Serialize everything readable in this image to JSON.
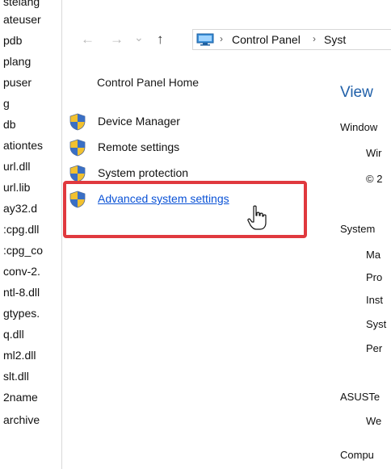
{
  "left_files": [
    "stelang",
    "ateuser",
    "pdb",
    "plang",
    "puser",
    "g",
    "db",
    "ationtes",
    "url.dll",
    "url.lib",
    "ay32.d",
    ":cpg.dll",
    ":cpg_co",
    "conv-2.",
    "ntl-8.dll",
    "gtypes.",
    "q.dll",
    "ml2.dll",
    "slt.dll",
    "2name",
    "archive"
  ],
  "address": {
    "back_glyph": "←",
    "forward_glyph": "→",
    "dropdown_glyph": "⌄",
    "up_glyph": "↑",
    "sep": "›",
    "crumbs": [
      "Control Panel",
      "Syst"
    ]
  },
  "sidebar": {
    "home": "Control Panel Home",
    "tasks": [
      {
        "label": "Device Manager"
      },
      {
        "label": "Remote settings"
      },
      {
        "label": "System protection"
      },
      {
        "label": "Advanced system settings"
      }
    ]
  },
  "right": {
    "title": "View",
    "lines": [
      "Window",
      "Wir",
      "© 2",
      "System",
      "Ma",
      "Pro",
      "Inst",
      "Syst",
      "Per",
      "ASUSTe",
      "We",
      "Compu"
    ]
  },
  "colors": {
    "highlight": "#e0393e",
    "link": "#0a52d6",
    "title": "#1f5fa8"
  }
}
